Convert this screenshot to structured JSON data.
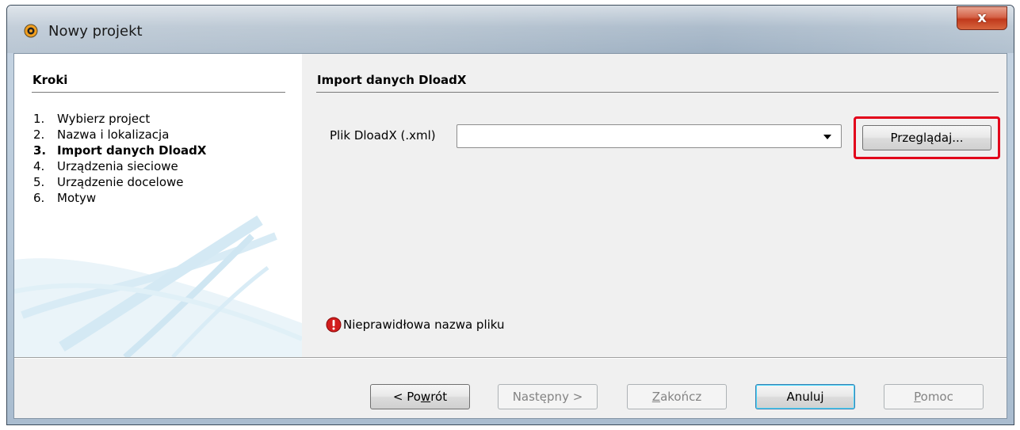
{
  "window": {
    "title": "Nowy projekt",
    "close_label": "x"
  },
  "steps": {
    "title": "Kroki",
    "items": [
      {
        "num": "1.",
        "label": "Wybierz project",
        "current": false
      },
      {
        "num": "2.",
        "label": "Nazwa i lokalizacja",
        "current": false
      },
      {
        "num": "3.",
        "label": "Import danych DloadX",
        "current": true
      },
      {
        "num": "4.",
        "label": "Urządzenia sieciowe",
        "current": false
      },
      {
        "num": "5.",
        "label": "Urządzenie docelowe",
        "current": false
      },
      {
        "num": "6.",
        "label": "Motyw",
        "current": false
      }
    ]
  },
  "main": {
    "section_title": "Import danych DloadX",
    "file_label": "Plik DloadX (.xml)",
    "file_value": "",
    "browse_label": "Przeglądaj...",
    "error_text": "Nieprawidłowa nazwa pliku"
  },
  "footer": {
    "back_pre": "< Po",
    "back_mnemonic": "w",
    "back_post": "rót",
    "next_label": "Następny >",
    "finish_mnemonic": "Z",
    "finish_post": "akończ",
    "cancel_label": "Anuluj",
    "help_mnemonic": "P",
    "help_post": "omoc"
  },
  "colors": {
    "highlight": "#e2001a",
    "error_icon": "#d21d1d",
    "swoosh": "#cfe6f2"
  }
}
